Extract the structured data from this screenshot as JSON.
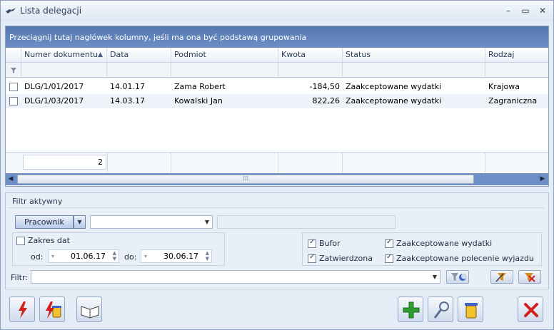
{
  "window": {
    "title": "Lista delegacji"
  },
  "grid": {
    "group_hint": "Przeciągnij tutaj nagłówek kolumny, jeśli ma ona być podstawą grupowania",
    "columns": [
      "Numer dokumentu",
      "Data",
      "Podmiot",
      "Kwota",
      "Status",
      "Rodzaj"
    ],
    "rows": [
      {
        "checked": false,
        "numer": "DLG/1/01/2017",
        "data": "14.01.17",
        "podmiot": "Zama Robert",
        "kwota": "-184,50",
        "status": "Zaakceptowane wydatki",
        "rodzaj": "Krajowa"
      },
      {
        "checked": false,
        "numer": "DLG/1/03/2017",
        "data": "14.03.17",
        "podmiot": "Kowalski Jan",
        "kwota": "822,26",
        "status": "Zaakceptowane wydatki",
        "rodzaj": "Zagraniczna"
      }
    ],
    "row_count": "2",
    "sort_indicator": "▲"
  },
  "filter_panel": {
    "title": "Filtr aktywny",
    "type_selector": "Pracownik",
    "employee_value": "",
    "employee_name": "",
    "date_range": {
      "label": "Zakres dat",
      "checked": false,
      "from_label": "od:",
      "from": "01.06.17",
      "to_label": "do:",
      "to": "30.06.17"
    },
    "statuses": [
      {
        "label": "Bufor",
        "checked": true
      },
      {
        "label": "Zaakceptowane wydatki",
        "checked": true
      },
      {
        "label": "Zatwierdzona",
        "checked": true
      },
      {
        "label": "Zaakceptowane polecenie wyjazdu",
        "checked": true
      }
    ],
    "filter_label": "Filtr:",
    "filter_value": ""
  },
  "colors": {
    "accent": "#5478b0",
    "title_text": "#2b3c57",
    "add_green": "#2e9e2e",
    "close_red": "#d0211c"
  }
}
